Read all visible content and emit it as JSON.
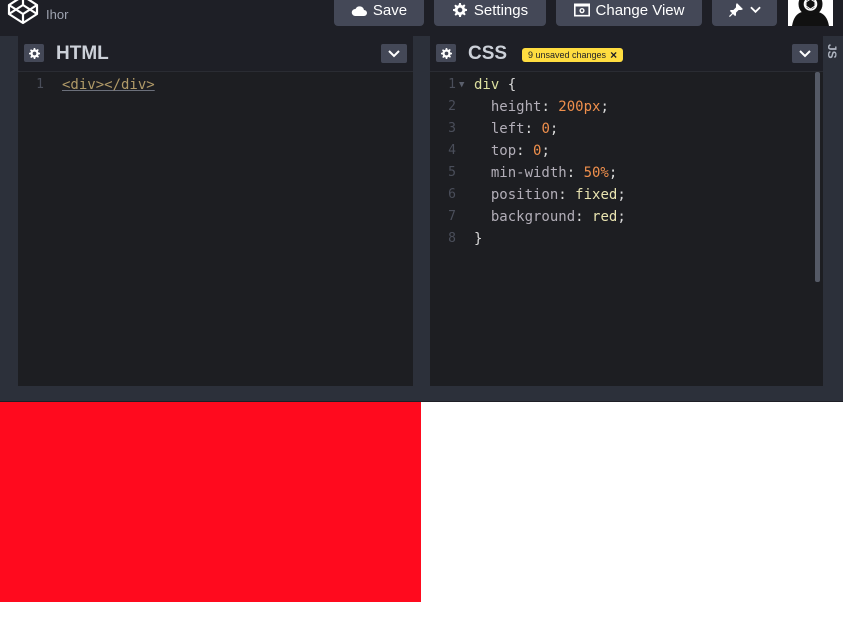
{
  "topbar": {
    "username": "Ihor",
    "save_label": "Save",
    "settings_label": "Settings",
    "change_view_label": "Change View"
  },
  "html_panel": {
    "title": "HTML",
    "lines": [
      {
        "n": "1",
        "parts": [
          {
            "t": "<div></div>",
            "c": "t-tag"
          }
        ]
      }
    ]
  },
  "css_panel": {
    "title": "CSS",
    "badge": "9 unsaved changes",
    "lines": [
      {
        "n": "1",
        "parts": [
          {
            "t": "div",
            "c": "t-sel"
          },
          {
            "t": " {",
            "c": "t-punc"
          }
        ]
      },
      {
        "n": "2",
        "parts": [
          {
            "t": "  height",
            "c": "t-prop"
          },
          {
            "t": ": ",
            "c": "t-punc"
          },
          {
            "t": "200px",
            "c": "t-num"
          },
          {
            "t": ";",
            "c": "t-punc"
          }
        ]
      },
      {
        "n": "3",
        "parts": [
          {
            "t": "  left",
            "c": "t-prop"
          },
          {
            "t": ": ",
            "c": "t-punc"
          },
          {
            "t": "0",
            "c": "t-num"
          },
          {
            "t": ";",
            "c": "t-punc"
          }
        ]
      },
      {
        "n": "4",
        "parts": [
          {
            "t": "  top",
            "c": "t-prop"
          },
          {
            "t": ": ",
            "c": "t-punc"
          },
          {
            "t": "0",
            "c": "t-num"
          },
          {
            "t": ";",
            "c": "t-punc"
          }
        ]
      },
      {
        "n": "5",
        "parts": [
          {
            "t": "  min-width",
            "c": "t-prop"
          },
          {
            "t": ": ",
            "c": "t-punc"
          },
          {
            "t": "50%",
            "c": "t-num"
          },
          {
            "t": ";",
            "c": "t-punc"
          }
        ]
      },
      {
        "n": "6",
        "parts": [
          {
            "t": "  position",
            "c": "t-prop"
          },
          {
            "t": ": ",
            "c": "t-punc"
          },
          {
            "t": "fixed",
            "c": "t-val"
          },
          {
            "t": ";",
            "c": "t-punc"
          }
        ]
      },
      {
        "n": "7",
        "parts": [
          {
            "t": "  background",
            "c": "t-prop"
          },
          {
            "t": ": ",
            "c": "t-punc"
          },
          {
            "t": "red",
            "c": "t-val"
          },
          {
            "t": ";",
            "c": "t-punc"
          }
        ]
      },
      {
        "n": "8",
        "parts": [
          {
            "t": "}",
            "c": "t-punc"
          }
        ]
      }
    ]
  },
  "js_tab": {
    "label": "JS"
  },
  "colors": {
    "preview_box": "#ff0a1e",
    "badge": "#ffdd40",
    "button": "#444857",
    "editor_bg": "#1d1e22"
  },
  "icons": [
    "codepen-logo-icon",
    "cloud-icon",
    "gear-icon",
    "eye-window-icon",
    "pin-icon",
    "chevron-down-icon",
    "close-icon"
  ]
}
